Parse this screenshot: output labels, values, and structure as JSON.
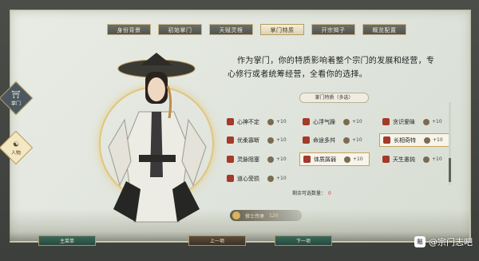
{
  "tabs": [
    {
      "label": "身份背景",
      "active": false
    },
    {
      "label": "初始掌门",
      "active": false
    },
    {
      "label": "天赋灵根",
      "active": false
    },
    {
      "label": "掌门特质",
      "active": true
    },
    {
      "label": "开宗揭子",
      "active": false
    },
    {
      "label": "概览配置",
      "active": false
    }
  ],
  "side": {
    "sect_label": "掌门",
    "person_label": "人物"
  },
  "intro": "作为掌门，你的特质影响着整个宗门的发展和经营，专心修行或者统筹经营，全看你的选择。",
  "traits_header": "掌门特质（多选）",
  "traits": [
    [
      {
        "name": "心神不定",
        "value": "+10",
        "color": "#a33a2a",
        "selected": false
      },
      {
        "name": "心浮气躁",
        "value": "+10",
        "color": "#a33a2a",
        "selected": false
      },
      {
        "name": "贪识爱昧",
        "value": "+10",
        "color": "#a33a2a",
        "selected": false
      }
    ],
    [
      {
        "name": "优柔寡断",
        "value": "+10",
        "color": "#a33a2a",
        "selected": false
      },
      {
        "name": "命途多舛",
        "value": "+10",
        "color": "#a33a2a",
        "selected": false
      },
      {
        "name": "长相奇特",
        "value": "+10",
        "color": "#a33a2a",
        "selected": true
      }
    ],
    [
      {
        "name": "灵脉阻塞",
        "value": "+10",
        "color": "#a33a2a",
        "selected": false
      },
      {
        "name": "体质孱弱",
        "value": "+10",
        "color": "#a33a2a",
        "selected": true
      },
      {
        "name": "天生愚钝",
        "value": "+10",
        "color": "#a33a2a",
        "selected": false
      }
    ],
    [
      {
        "name": "道心受损",
        "value": "+10",
        "color": "#a33a2a",
        "selected": false
      }
    ]
  ],
  "remaining": {
    "label": "剩余可选数量：",
    "value": "0"
  },
  "tag": {
    "label": "修士传承",
    "score": "120"
  },
  "buttons": {
    "main": "主菜单",
    "prev": "上一项",
    "next": "下一项"
  },
  "watermark": "@宗门志吧",
  "watermark_logo": "贴"
}
